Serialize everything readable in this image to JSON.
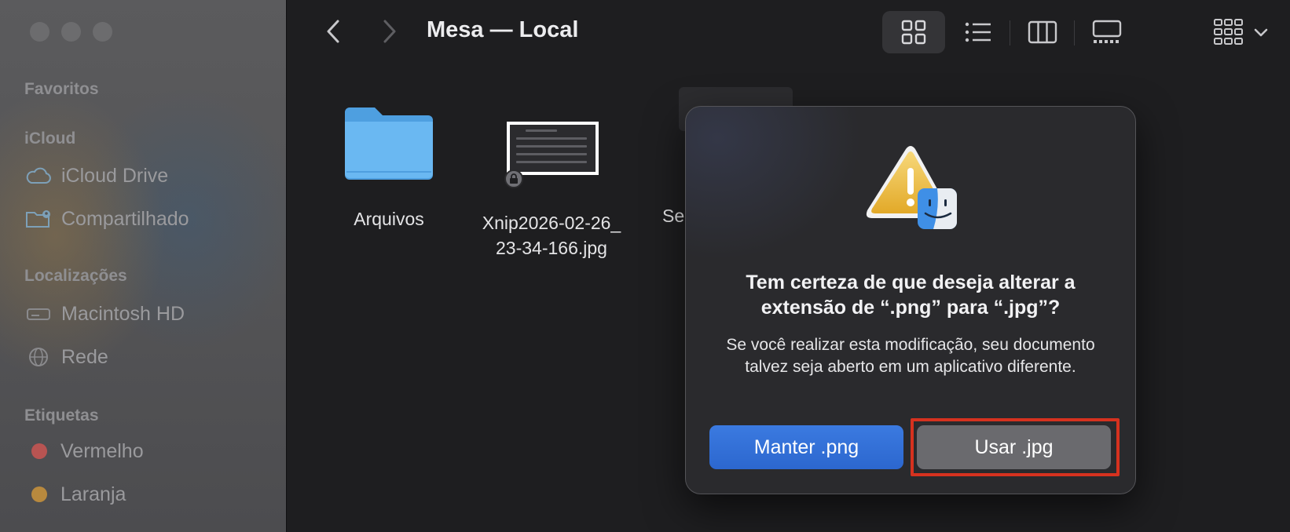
{
  "window": {
    "title": "Mesa — Local"
  },
  "sidebar": {
    "sections": {
      "favorites": "Favoritos",
      "icloud": "iCloud",
      "locations": "Localizações",
      "tags": "Etiquetas"
    },
    "icloud_items": [
      {
        "label": "iCloud Drive",
        "icon": "cloud-icon"
      },
      {
        "label": "Compartilhado",
        "icon": "shared-folder-icon"
      }
    ],
    "location_items": [
      {
        "label": "Macintosh HD",
        "icon": "hard-drive-icon"
      },
      {
        "label": "Rede",
        "icon": "network-globe-icon"
      }
    ],
    "tag_items": [
      {
        "label": "Vermelho",
        "color": "#b85452"
      },
      {
        "label": "Laranja",
        "color": "#b8893e"
      }
    ]
  },
  "toolbar": {
    "views": [
      "icon-view",
      "list-view",
      "column-view",
      "gallery-view",
      "group-view"
    ],
    "active_view": "icon-view"
  },
  "files": [
    {
      "name": "Arquivos",
      "kind": "folder"
    },
    {
      "name_line1": "Xnip2026-02-26_",
      "name_line2": "23-34-166.jpg",
      "kind": "image",
      "locked": true
    },
    {
      "name_partial": "Se",
      "kind": "partially-hidden"
    }
  ],
  "dialog": {
    "title": "Tem certeza de que deseja alterar a extensão de “.png” para “.jpg”?",
    "message": "Se você realizar esta modificação, seu documento talvez seja aberto em um aplicativo diferente.",
    "keep_button": "Manter .png",
    "use_button": "Usar .jpg",
    "highlight_color": "#d6321f"
  }
}
